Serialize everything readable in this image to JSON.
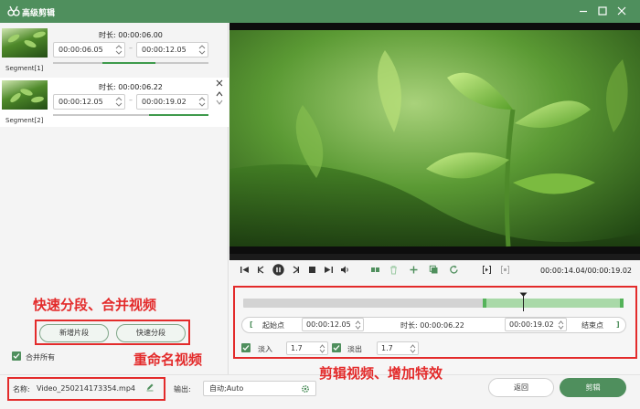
{
  "window": {
    "title": "高级剪辑",
    "accent": "#4f8f5d"
  },
  "segments": [
    {
      "label": "Segment[1]",
      "duration_label": "时长: 00:00:06.00",
      "start": "00:00:06.05",
      "end": "00:00:12.05",
      "progress": [
        0.32,
        0.66
      ]
    },
    {
      "label": "Segment[2]",
      "duration_label": "时长: 00:00:06.22",
      "start": "00:00:12.05",
      "end": "00:00:19.02",
      "progress": [
        0.62,
        1.0
      ]
    }
  ],
  "left_actions": {
    "add_segment": "新增片段",
    "fast_split": "快速分段",
    "merge_all": "合并所有"
  },
  "annotations": {
    "split_merge": "快速分段、合并视频",
    "rename": "重命名视频",
    "edit_effects": "剪辑视频、增加特效"
  },
  "player": {
    "timecode": "00:00:14.04/00:00:19.02",
    "timeline_selection": [
      0.63,
      1.0
    ],
    "playhead": 0.735
  },
  "trim": {
    "start_point": "起始点",
    "start_time": "00:00:12.05",
    "duration": "时长: 00:00:06.22",
    "end_time": "00:00:19.02",
    "end_point": "结束点",
    "fade_in_label": "淡入",
    "fade_in_value": "1.7",
    "fade_out_label": "淡出",
    "fade_out_value": "1.7"
  },
  "bottom": {
    "name_label": "名称:",
    "name_value": "Video_250214173354.mp4",
    "output_label": "输出:",
    "output_value": "自动;Auto",
    "back": "返回",
    "cut": "剪辑"
  }
}
